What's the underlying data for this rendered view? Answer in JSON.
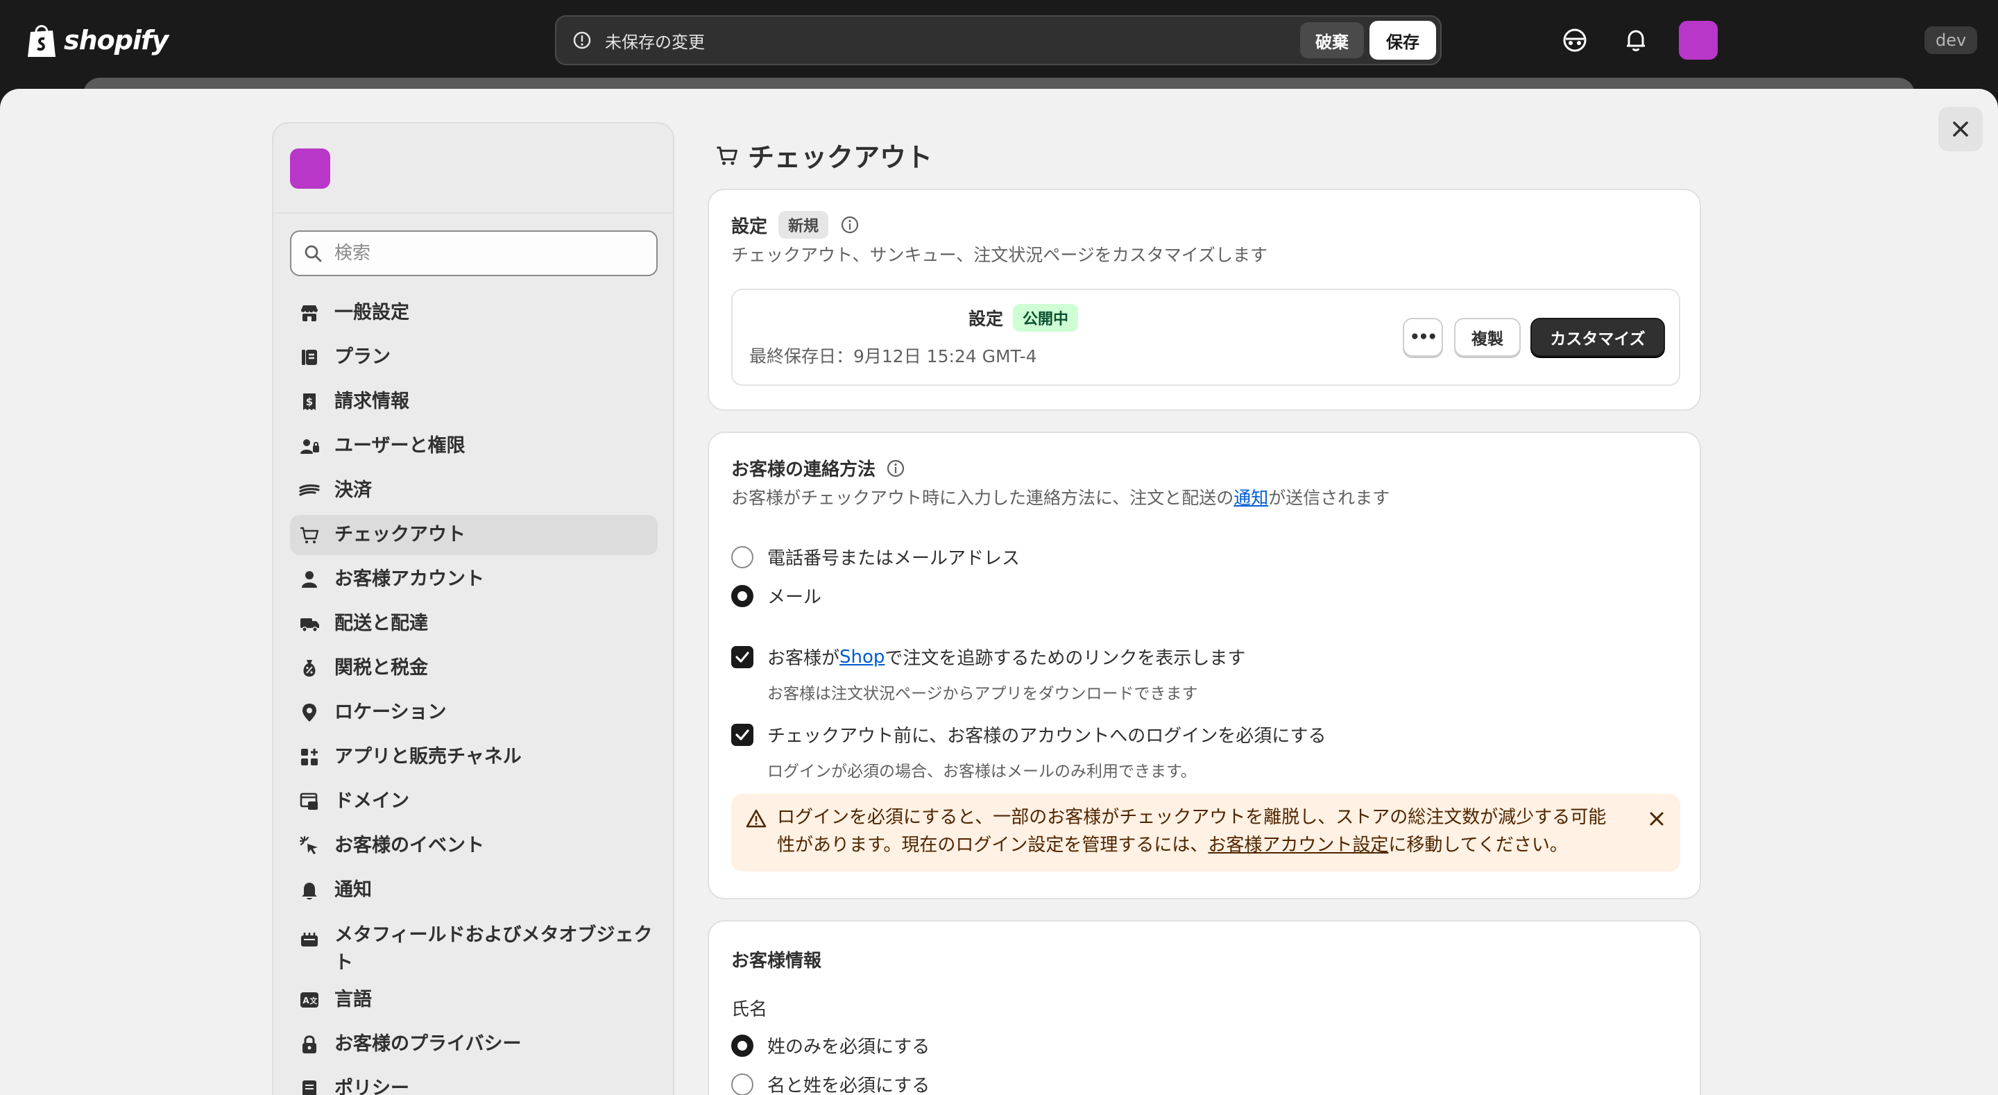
{
  "topbar": {
    "brand": "shopify",
    "unsaved_text": "未保存の変更",
    "discard_label": "破棄",
    "save_label": "保存",
    "dev_label": "dev"
  },
  "sidebar": {
    "search_placeholder": "検索",
    "items": [
      {
        "label": "一般設定",
        "icon": "store-icon"
      },
      {
        "label": "プラン",
        "icon": "plan-icon"
      },
      {
        "label": "請求情報",
        "icon": "receipt-icon"
      },
      {
        "label": "ユーザーと権限",
        "icon": "users-icon"
      },
      {
        "label": "決済",
        "icon": "payments-icon"
      },
      {
        "label": "チェックアウト",
        "icon": "cart-icon",
        "active": true
      },
      {
        "label": "お客様アカウント",
        "icon": "person-icon"
      },
      {
        "label": "配送と配達",
        "icon": "truck-icon"
      },
      {
        "label": "関税と税金",
        "icon": "tax-icon"
      },
      {
        "label": "ロケーション",
        "icon": "location-icon"
      },
      {
        "label": "アプリと販売チャネル",
        "icon": "apps-icon"
      },
      {
        "label": "ドメイン",
        "icon": "domain-icon"
      },
      {
        "label": "お客様のイベント",
        "icon": "cursor-icon"
      },
      {
        "label": "通知",
        "icon": "bell-icon"
      },
      {
        "label": "メタフィールドおよびメタオブジェクト",
        "icon": "metafield-icon"
      },
      {
        "label": "言語",
        "icon": "language-icon"
      },
      {
        "label": "お客様のプライバシー",
        "icon": "lock-icon"
      },
      {
        "label": "ポリシー",
        "icon": "policy-icon"
      }
    ]
  },
  "page": {
    "title": "チェックアウト"
  },
  "settings_card": {
    "title": "設定",
    "new_badge": "新規",
    "subtitle": "チェックアウト、サンキュー、注文状況ページをカスタマイズします",
    "config_name": "設定",
    "live_badge": "公開中",
    "last_saved": "最終保存日：9月12日 15:24 GMT-4",
    "more_label": "•••",
    "duplicate_label": "複製",
    "customize_label": "カスタマイズ"
  },
  "contact_card": {
    "title": "お客様の連絡方法",
    "subtitle_pre": "お客様がチェックアウト時に入力した連絡方法に、注文と配送の",
    "subtitle_link": "通知",
    "subtitle_post": "が送信されます",
    "radio_phone_email": "電話番号またはメールアドレス",
    "radio_email": "メール",
    "selected": "email",
    "check_shop_pre": "お客様が",
    "check_shop_link": "Shop",
    "check_shop_post": "で注文を追跡するためのリンクを表示します",
    "check_shop_helper": "お客様は注文状況ページからアプリをダウンロードできます",
    "check_login": "チェックアウト前に、お客様のアカウントへのログインを必須にする",
    "check_login_helper": "ログインが必須の場合、お客様はメールのみ利用できます。",
    "warning_pre": "ログインを必須にすると、一部のお客様がチェックアウトを離脱し、ストアの総注文数が減少する可能性があります。現在のログイン設定を管理するには、",
    "warning_link": "お客様アカウント設定",
    "warning_post": "に移動してください。"
  },
  "customer_info_card": {
    "title": "お客様情報",
    "name_label": "氏名",
    "radio_last_only": "姓のみを必須にする",
    "radio_first_last": "名と姓を必須にする",
    "selected": "last_only"
  },
  "colors": {
    "accent_purple": "#b937c8",
    "link_blue": "#005bd3",
    "warning_bg": "#fff1e3",
    "success_bg": "#cdfed4"
  }
}
